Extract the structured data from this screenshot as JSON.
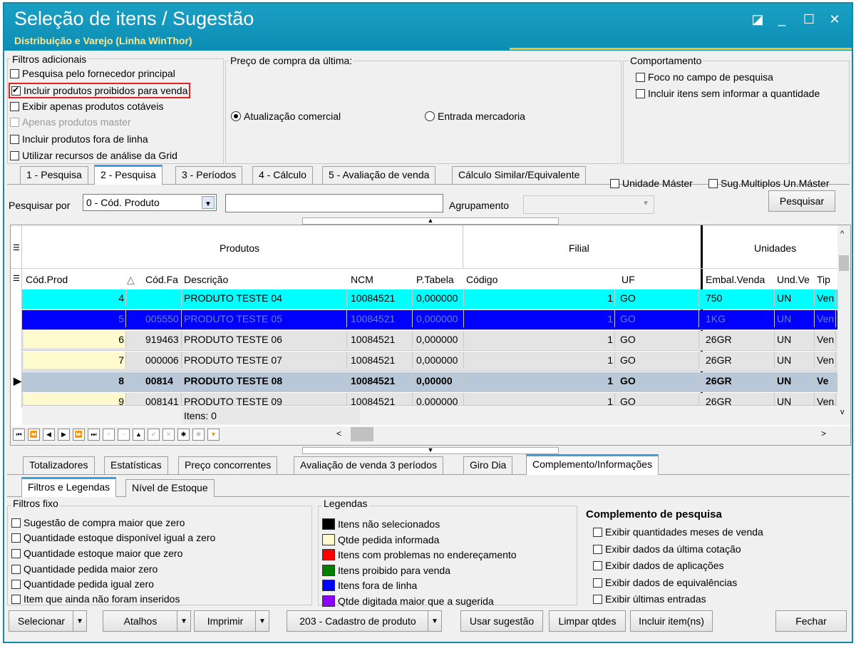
{
  "window": {
    "title": "Seleção de itens / Sugestão",
    "subtitle": "Distribuição e Varejo (Linha WinThor)"
  },
  "filters": {
    "legend": "Filtros adicionais",
    "items": [
      {
        "label": "Pesquisa pelo fornecedor principal",
        "checked": false
      },
      {
        "label": "Incluir produtos proibidos para venda",
        "checked": true
      },
      {
        "label": "Exibir apenas produtos cotáveis",
        "checked": false
      },
      {
        "label": "Apenas produtos master",
        "checked": false,
        "disabled": true
      },
      {
        "label": "Incluir produtos fora de linha",
        "checked": false
      },
      {
        "label": "Utilizar recursos de análise da Grid",
        "checked": false
      }
    ]
  },
  "price": {
    "legend": "Preço de compra da última:",
    "opt1": "Atualização comercial",
    "opt2": "Entrada mercadoria"
  },
  "behavior": {
    "legend": "Comportamento",
    "opt1": "Foco no campo de pesquisa",
    "opt2": "Incluir itens sem informar a quantidade"
  },
  "tabs": [
    "1 - Pesquisa",
    "2 - Pesquisa",
    "3 - Períodos",
    "4 - Cálculo",
    "5 - Avaliação de venda",
    "Cálculo Similar/Equivalente"
  ],
  "extra_checks": {
    "master": "Unidade Máster",
    "multiplos": "Sug.Multiplos Un.Máster"
  },
  "search": {
    "label": "Pesquisar por",
    "select": "0 - Cód. Produto",
    "value": "",
    "grouping_label": "Agrupamento",
    "grouping_value": "",
    "button": "Pesquisar"
  },
  "grid": {
    "bands": {
      "produtos": "Produtos",
      "filial": "Filial",
      "unidades": "Unidades"
    },
    "columns": [
      "Cód.Prod",
      "Cód.Fa",
      "Descrição",
      "NCM",
      "P.Tabela",
      "Código",
      "UF",
      "Embal.Venda",
      "Und.Ve",
      "Tip"
    ],
    "rows": [
      [
        "4",
        "",
        "PRODUTO TESTE 04",
        "10084521",
        "0,000000",
        "1",
        "GO",
        "750",
        "UN",
        "Ven"
      ],
      [
        "5",
        "005550",
        "PRODUTO TESTE 05",
        "10084521",
        "0,000000",
        "1",
        "GO",
        "1KG",
        "UN",
        "Ven"
      ],
      [
        "6",
        "919463",
        "PRODUTO TESTE 06",
        "10084521",
        "0,000000",
        "1",
        "GO",
        "26GR",
        "UN",
        "Ven"
      ],
      [
        "7",
        "000006",
        "PRODUTO TESTE 07",
        "10084521",
        "0,000000",
        "1",
        "GO",
        "26GR",
        "UN",
        "Ven"
      ],
      [
        "8",
        "00814",
        "PRODUTO TESTE 08",
        "10084521",
        "0,00000",
        "1",
        "GO",
        "26GR",
        "UN",
        "Ve"
      ],
      [
        "9",
        "008141",
        "PRODUTO TESTE 09",
        "10084521",
        "0,000000",
        "1",
        "GO",
        "26GR",
        "UN",
        "Ven"
      ]
    ],
    "footer": "Itens: 0"
  },
  "bottom_tabs": [
    "Totalizadores",
    "Estatísticas",
    "Preço concorrentes",
    "Avaliação de venda 3 períodos",
    "Giro Dia",
    "Complemento/Informações"
  ],
  "sub_tabs": [
    "Filtros e Legendas",
    "Nível de Estoque"
  ],
  "fixed_filters": {
    "legend": "Filtros fixo",
    "items": [
      "Sugestão de compra maior que zero",
      "Quantidade estoque disponível igual a zero",
      "Quantidade estoque maior que zero",
      "Quantidade pedida maior zero",
      "Quantidade pedida igual zero",
      "Item que ainda não foram inseridos"
    ]
  },
  "legends": {
    "legend": "Legendas",
    "items": [
      {
        "label": "Itens não selecionados",
        "color": "#000000"
      },
      {
        "label": "Qtde pedida informada",
        "color": "#fffacd"
      },
      {
        "label": "Itens com problemas no endereçamento",
        "color": "#ff0000"
      },
      {
        "label": "Itens proibido para venda",
        "color": "#008000"
      },
      {
        "label": "Itens fora de linha",
        "color": "#0000ff"
      },
      {
        "label": "Qtde digitada maior que a sugerida",
        "color": "#8b00ff"
      }
    ]
  },
  "complement": {
    "title": "Complemento de pesquisa",
    "items": [
      "Exibir quantidades meses de venda",
      "Exibir dados da última cotação",
      "Exibir dados de aplicações",
      "Exibir dados de equivalências",
      "Exibir últimas entradas"
    ]
  },
  "buttons": {
    "selecionar": "Selecionar",
    "atalhos": "Atalhos",
    "imprimir": "Imprimir",
    "cadastro": "203 - Cadastro de produto",
    "usar": "Usar sugestão",
    "limpar": "Limpar qtdes",
    "incluir": "Incluir item(ns)",
    "fechar": "Fechar"
  }
}
